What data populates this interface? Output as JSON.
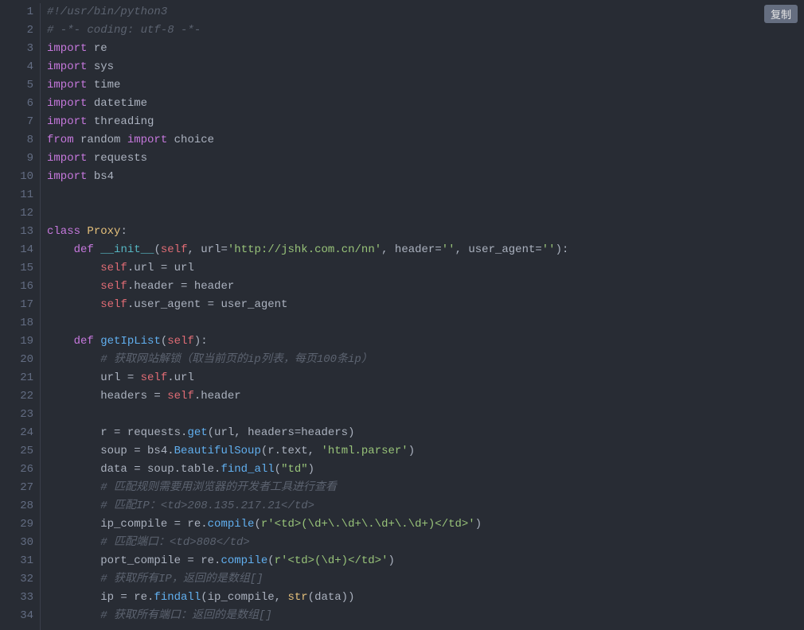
{
  "copy_button_label": "复制",
  "colors": {
    "background": "#282c34",
    "gutter": "#636d83",
    "comment": "#5c6370",
    "keyword": "#c678dd",
    "string": "#98c379",
    "builtin": "#e5c07b",
    "func": "#61afef",
    "self": "#e06c75",
    "magic": "#56b6c2",
    "default": "#abb2bf"
  },
  "lines": [
    {
      "n": 1,
      "tokens": [
        {
          "t": "#!/usr/bin/python3",
          "c": "comment"
        }
      ]
    },
    {
      "n": 2,
      "tokens": [
        {
          "t": "# -*- coding: utf-8 -*-",
          "c": "comment"
        }
      ]
    },
    {
      "n": 3,
      "tokens": [
        {
          "t": "import",
          "c": "keyword"
        },
        {
          "t": " re",
          "c": "default"
        }
      ]
    },
    {
      "n": 4,
      "tokens": [
        {
          "t": "import",
          "c": "keyword"
        },
        {
          "t": " sys",
          "c": "default"
        }
      ]
    },
    {
      "n": 5,
      "tokens": [
        {
          "t": "import",
          "c": "keyword"
        },
        {
          "t": " time",
          "c": "default"
        }
      ]
    },
    {
      "n": 6,
      "tokens": [
        {
          "t": "import",
          "c": "keyword"
        },
        {
          "t": " datetime",
          "c": "default"
        }
      ]
    },
    {
      "n": 7,
      "tokens": [
        {
          "t": "import",
          "c": "keyword"
        },
        {
          "t": " threading",
          "c": "default"
        }
      ]
    },
    {
      "n": 8,
      "tokens": [
        {
          "t": "from",
          "c": "keyword"
        },
        {
          "t": " random ",
          "c": "default"
        },
        {
          "t": "import",
          "c": "keyword"
        },
        {
          "t": " choice",
          "c": "default"
        }
      ]
    },
    {
      "n": 9,
      "tokens": [
        {
          "t": "import",
          "c": "keyword"
        },
        {
          "t": " requests",
          "c": "default"
        }
      ]
    },
    {
      "n": 10,
      "tokens": [
        {
          "t": "import",
          "c": "keyword"
        },
        {
          "t": " bs4",
          "c": "default"
        }
      ]
    },
    {
      "n": 11,
      "tokens": []
    },
    {
      "n": 12,
      "tokens": []
    },
    {
      "n": 13,
      "tokens": [
        {
          "t": "class",
          "c": "keyword"
        },
        {
          "t": " ",
          "c": "default"
        },
        {
          "t": "Proxy",
          "c": "builtin"
        },
        {
          "t": ":",
          "c": "default"
        }
      ]
    },
    {
      "n": 14,
      "tokens": [
        {
          "t": "    ",
          "c": "default"
        },
        {
          "t": "def",
          "c": "keyword"
        },
        {
          "t": " ",
          "c": "default"
        },
        {
          "t": "__init__",
          "c": "magic"
        },
        {
          "t": "(",
          "c": "default"
        },
        {
          "t": "self",
          "c": "self"
        },
        {
          "t": ", url=",
          "c": "default"
        },
        {
          "t": "'http://jshk.com.cn/nn'",
          "c": "string"
        },
        {
          "t": ", header=",
          "c": "default"
        },
        {
          "t": "''",
          "c": "string"
        },
        {
          "t": ", user_agent=",
          "c": "default"
        },
        {
          "t": "''",
          "c": "string"
        },
        {
          "t": "):",
          "c": "default"
        }
      ]
    },
    {
      "n": 15,
      "tokens": [
        {
          "t": "        ",
          "c": "default"
        },
        {
          "t": "self",
          "c": "self"
        },
        {
          "t": ".url = url",
          "c": "default"
        }
      ]
    },
    {
      "n": 16,
      "tokens": [
        {
          "t": "        ",
          "c": "default"
        },
        {
          "t": "self",
          "c": "self"
        },
        {
          "t": ".header = header",
          "c": "default"
        }
      ]
    },
    {
      "n": 17,
      "tokens": [
        {
          "t": "        ",
          "c": "default"
        },
        {
          "t": "self",
          "c": "self"
        },
        {
          "t": ".user_agent = user_agent",
          "c": "default"
        }
      ]
    },
    {
      "n": 18,
      "tokens": []
    },
    {
      "n": 19,
      "tokens": [
        {
          "t": "    ",
          "c": "default"
        },
        {
          "t": "def",
          "c": "keyword"
        },
        {
          "t": " ",
          "c": "default"
        },
        {
          "t": "getIpList",
          "c": "func"
        },
        {
          "t": "(",
          "c": "default"
        },
        {
          "t": "self",
          "c": "self"
        },
        {
          "t": "):",
          "c": "default"
        }
      ]
    },
    {
      "n": 20,
      "tokens": [
        {
          "t": "        ",
          "c": "default"
        },
        {
          "t": "# 获取网站解锁（取当前页的ip列表，每页100条ip）",
          "c": "comment"
        }
      ]
    },
    {
      "n": 21,
      "tokens": [
        {
          "t": "        url = ",
          "c": "default"
        },
        {
          "t": "self",
          "c": "self"
        },
        {
          "t": ".url",
          "c": "default"
        }
      ]
    },
    {
      "n": 22,
      "tokens": [
        {
          "t": "        headers = ",
          "c": "default"
        },
        {
          "t": "self",
          "c": "self"
        },
        {
          "t": ".header",
          "c": "default"
        }
      ]
    },
    {
      "n": 23,
      "tokens": []
    },
    {
      "n": 24,
      "tokens": [
        {
          "t": "        r = requests.",
          "c": "default"
        },
        {
          "t": "get",
          "c": "func"
        },
        {
          "t": "(url, headers=headers)",
          "c": "default"
        }
      ]
    },
    {
      "n": 25,
      "tokens": [
        {
          "t": "        soup = bs4.",
          "c": "default"
        },
        {
          "t": "BeautifulSoup",
          "c": "func"
        },
        {
          "t": "(r.text, ",
          "c": "default"
        },
        {
          "t": "'html.parser'",
          "c": "string"
        },
        {
          "t": ")",
          "c": "default"
        }
      ]
    },
    {
      "n": 26,
      "tokens": [
        {
          "t": "        data = soup.table.",
          "c": "default"
        },
        {
          "t": "find_all",
          "c": "func"
        },
        {
          "t": "(",
          "c": "default"
        },
        {
          "t": "\"td\"",
          "c": "string"
        },
        {
          "t": ")",
          "c": "default"
        }
      ]
    },
    {
      "n": 27,
      "tokens": [
        {
          "t": "        ",
          "c": "default"
        },
        {
          "t": "# 匹配规则需要用浏览器的开发者工具进行查看",
          "c": "comment"
        }
      ]
    },
    {
      "n": 28,
      "tokens": [
        {
          "t": "        ",
          "c": "default"
        },
        {
          "t": "# 匹配IP：<td>208.135.217.21</td>",
          "c": "comment"
        }
      ]
    },
    {
      "n": 29,
      "tokens": [
        {
          "t": "        ip_compile = re.",
          "c": "default"
        },
        {
          "t": "compile",
          "c": "func"
        },
        {
          "t": "(",
          "c": "default"
        },
        {
          "t": "r'<td>(\\d+\\.\\d+\\.\\d+\\.\\d+)</td>'",
          "c": "string"
        },
        {
          "t": ")",
          "c": "default"
        }
      ]
    },
    {
      "n": 30,
      "tokens": [
        {
          "t": "        ",
          "c": "default"
        },
        {
          "t": "# 匹配端口：<td>808</td>",
          "c": "comment"
        }
      ]
    },
    {
      "n": 31,
      "tokens": [
        {
          "t": "        port_compile = re.",
          "c": "default"
        },
        {
          "t": "compile",
          "c": "func"
        },
        {
          "t": "(",
          "c": "default"
        },
        {
          "t": "r'<td>(\\d+)</td>'",
          "c": "string"
        },
        {
          "t": ")",
          "c": "default"
        }
      ]
    },
    {
      "n": 32,
      "tokens": [
        {
          "t": "        ",
          "c": "default"
        },
        {
          "t": "# 获取所有IP，返回的是数组[]",
          "c": "comment"
        }
      ]
    },
    {
      "n": 33,
      "tokens": [
        {
          "t": "        ip = re.",
          "c": "default"
        },
        {
          "t": "findall",
          "c": "func"
        },
        {
          "t": "(ip_compile, ",
          "c": "default"
        },
        {
          "t": "str",
          "c": "builtin"
        },
        {
          "t": "(data))",
          "c": "default"
        }
      ]
    },
    {
      "n": 34,
      "tokens": [
        {
          "t": "        ",
          "c": "default"
        },
        {
          "t": "# 获取所有端口：返回的是数组[]",
          "c": "comment"
        }
      ]
    }
  ]
}
